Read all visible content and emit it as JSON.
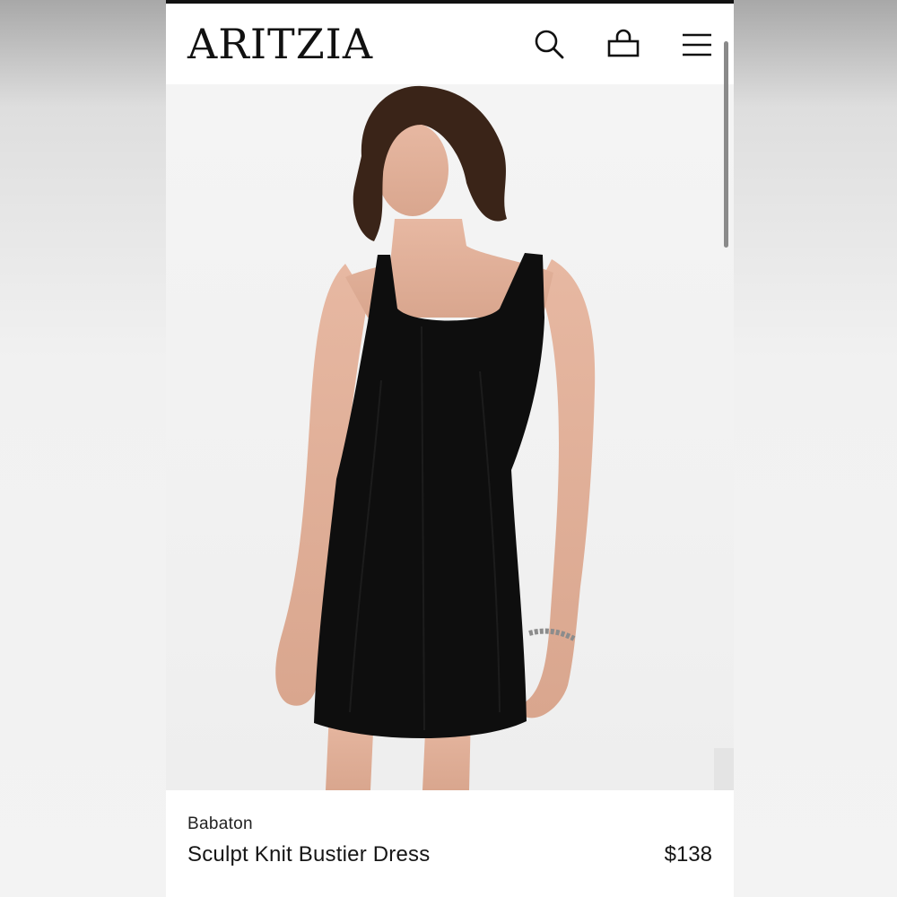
{
  "header": {
    "logo": "ARITZIA",
    "icons": [
      "search-icon",
      "shopping-bag-icon",
      "hamburger-menu-icon"
    ]
  },
  "product": {
    "brand": "Babaton",
    "name": "Sculpt Knit Bustier Dress",
    "price": "$138",
    "dress_color": "#0e0e0e"
  },
  "colors": {
    "background": "#ffffff",
    "text": "#161616",
    "image_bg": "#f3f3f3"
  }
}
